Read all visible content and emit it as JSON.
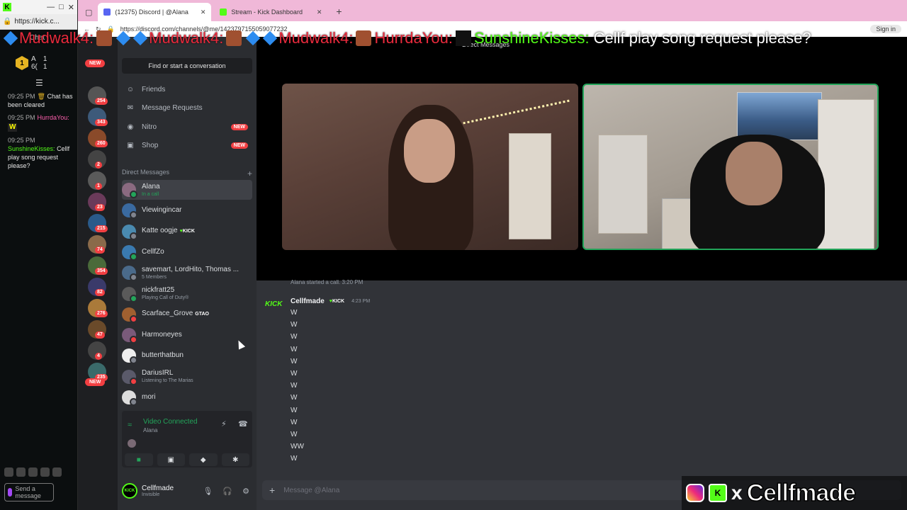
{
  "kick_window": {
    "url": "https://kick.c...",
    "chat_label": "Chat",
    "stat_a": "A",
    "stat_b": "6(",
    "count1": "1",
    "count2": "1",
    "messages": [
      {
        "time": "09:25 PM",
        "text": "Chat has been cleared"
      },
      {
        "time": "09:25 PM",
        "user": "HurrdaYou:",
        "emote": "W"
      },
      {
        "time": "09:25 PM",
        "user": "SunshineKisses:",
        "text": "Cellf play song request please?"
      }
    ],
    "send_placeholder": "Send a message"
  },
  "browser": {
    "tabs": [
      {
        "label": "(12375) Discord | @Alana",
        "active": true
      },
      {
        "label": "Stream - Kick Dashboard",
        "active": false
      }
    ],
    "url": "https://discord.com/channels/@me/1423797155059077232",
    "signin": "Sign in"
  },
  "ticker": {
    "name_a": "Mudwalk4:",
    "name_b": "Mudwalk4:",
    "name_c": "Mudwalk4:",
    "name_d": "HurrdaYou:",
    "name_e": "SunshineKisses:",
    "message": "Cellf play song request please?"
  },
  "discord": {
    "guild_badges": [
      "NEW",
      "254",
      "343",
      "260",
      "2",
      "1",
      "23",
      "215",
      "74",
      "354",
      "82",
      "276",
      "47",
      "4",
      "235",
      "NEW"
    ],
    "find_placeholder": "Find or start a conversation",
    "nav": [
      {
        "label": "Friends",
        "icon": "friends-icon"
      },
      {
        "label": "Message Requests",
        "icon": "mail-icon"
      },
      {
        "label": "Nitro",
        "icon": "nitro-icon",
        "tag": "NEW"
      },
      {
        "label": "Shop",
        "icon": "shop-icon",
        "tag": "NEW"
      }
    ],
    "dm_header": "Direct Messages",
    "dm_add": "+",
    "dms": [
      {
        "name": "Alana",
        "sub": "In a call",
        "status": "on",
        "selected": true
      },
      {
        "name": "Viewingincar",
        "sub": "",
        "status": "off"
      },
      {
        "name": "Katte oogje",
        "tag": "KICK",
        "sub": "",
        "status": "off"
      },
      {
        "name": "CellfZo",
        "sub": "",
        "status": "on"
      },
      {
        "name": "savemart, LordHito, Thomas ...",
        "sub": "5 Members",
        "status": "none"
      },
      {
        "name": "nickfratt25",
        "sub": "Playing Call of Duty®",
        "status": "on"
      },
      {
        "name": "Scarface_Grove",
        "tag": "GTAO",
        "sub": "",
        "status": "dnd"
      },
      {
        "name": "Harmoneyes",
        "sub": "",
        "status": "dnd"
      },
      {
        "name": "butterthatbun",
        "sub": "",
        "status": "off"
      },
      {
        "name": "DariusIRL",
        "sub": "Listening to The Marias",
        "status": "dnd"
      },
      {
        "name": "mori",
        "sub": "",
        "status": "off"
      }
    ],
    "voice": {
      "status": "Video Connected",
      "channel": "Alana"
    },
    "user": {
      "name": "Cellfmade",
      "status": "Invisible"
    },
    "call_title": "Direct Messages",
    "chat": {
      "system_line": "Alana started a call. 3:20 PM",
      "author": "Cellfmade",
      "author_tag": "KICK",
      "timestamp": "4:23 PM",
      "lines": [
        "W",
        "W",
        "W",
        "W",
        "W",
        "W",
        "W",
        "W",
        "W",
        "W",
        "W",
        "WW",
        "W"
      ],
      "composer_placeholder": "Message @Alana"
    }
  },
  "watermark": {
    "name": "Cellfmade",
    "x": "x"
  },
  "colors": {
    "kick_green": "#53fc18",
    "discord_bg": "#313338",
    "online": "#23a55a",
    "dnd": "#f23f42"
  }
}
